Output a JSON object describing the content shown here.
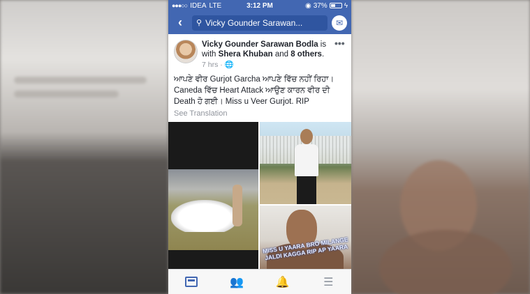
{
  "status_bar": {
    "signal": "●●●○○",
    "carrier": "IDEA",
    "network": "LTE",
    "time": "3:12 PM",
    "battery": "37%"
  },
  "nav": {
    "search_text": "Vicky Gounder Sarawan..."
  },
  "post": {
    "author": "Vicky Gounder Sarawan Bodla",
    "with_prefix": "is with",
    "tagged": "Shera Khuban",
    "and_text": "and",
    "others": "8 others",
    "time": "7 hrs",
    "text": "ਆਪਣੇ ਵੀਰ Gurjot Garcha ਆਪਣੇ ਵਿੱਚ ਨਹੀਂ ਰਿਹਾ। Caneda ਵਿੱਚ Heart Attack ਆਉਣ ਕਾਰਨ ਵੀਰ ਦੀ Death ਹੋ ਗਈ। Miss u Veer Gurjot. RIP",
    "see_translation": "See Translation",
    "photo_overlay_text": "MISS U YAARA BRO MILANGE JALDI KAGGA RIP AP YAARA"
  },
  "colors": {
    "brand": "#4267b2",
    "text": "#1d2129",
    "muted": "#90949c"
  },
  "tabs": [
    "news-feed-icon",
    "friends-icon",
    "notifications-icon",
    "menu-icon"
  ]
}
